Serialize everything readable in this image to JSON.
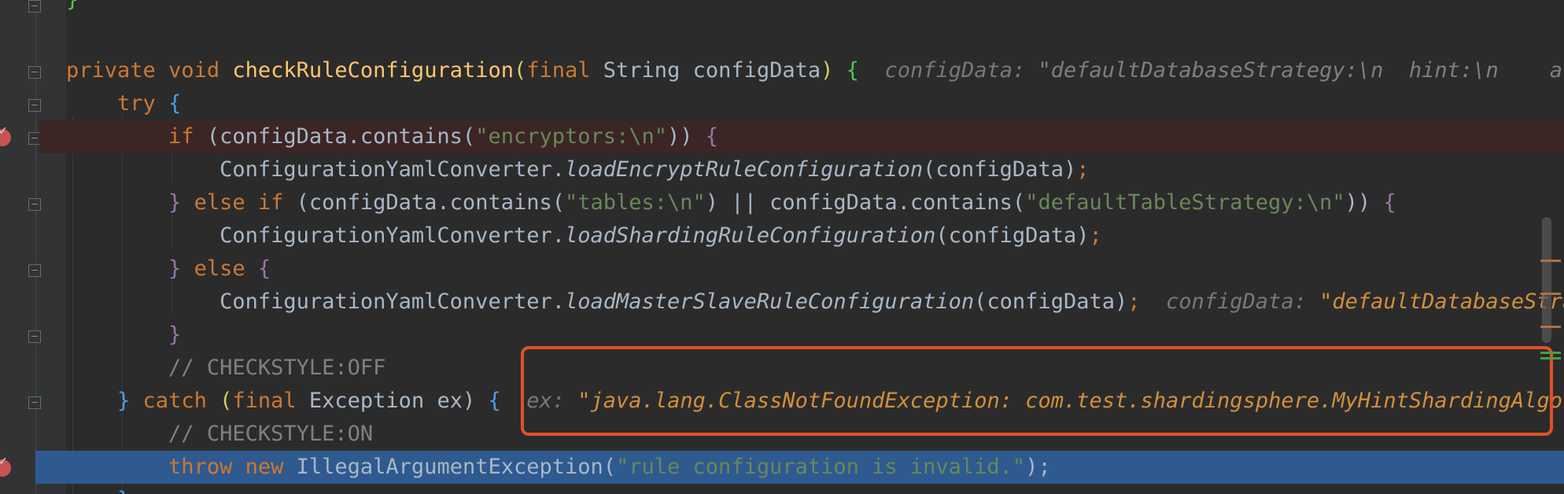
{
  "colors": {
    "background": "#2b2b2b",
    "keyword": "#cc7832",
    "method": "#ffc66d",
    "string": "#6a8759",
    "comment": "#808080",
    "execution_line": "#2f5a8f",
    "breakpoint_line": "#3b2525",
    "highlight_box": "#e0502a"
  },
  "lines": {
    "l0": {
      "brace": "}"
    },
    "l1": {
      "kw_private": "private",
      "kw_void": "void",
      "method": "checkRuleConfiguration",
      "open_paren": "(",
      "kw_final": "final",
      "params": " String configData",
      "close_paren": ")",
      "brace": " {",
      "inlay1_name": "configData:",
      "inlay1_value": " \"defaultDatabaseStrategy:\\n  hint:\\n    alg"
    },
    "l2": {
      "kw_try": "try",
      "brace": " {"
    },
    "l3": {
      "kw_if": "if",
      "pre": " (configData.contains(",
      "str": "\"encryptors:\\n\"",
      "post": "))",
      "brace": " {"
    },
    "l4": {
      "cls": "ConfigurationYamlConverter.",
      "method": "loadEncryptRuleConfiguration",
      "args": "(configData)",
      "semi": ";"
    },
    "l5": {
      "brace1": "}",
      "kw_else_if": " else if",
      "pre": " (configData.contains(",
      "str1": "\"tables:\\n\"",
      "mid": ") || configData.contains(",
      "str2": "\"defaultTableStrategy:\\n\"",
      "post": "))",
      "brace2": " {"
    },
    "l6": {
      "cls": "ConfigurationYamlConverter.",
      "method": "loadShardingRuleConfiguration",
      "args": "(configData)",
      "semi": ";"
    },
    "l7": {
      "brace1": "}",
      "kw_else": " else",
      "brace2": " {"
    },
    "l8": {
      "cls": "ConfigurationYamlConverter.",
      "method": "loadMasterSlaveRuleConfiguration",
      "args": "(configData)",
      "semi": ";",
      "inlay_name": "configData:",
      "inlay_value": " \"defaultDatabaseStrat"
    },
    "l9": {
      "brace": "}"
    },
    "l10": {
      "comment": "// CHECKSTYLE:OFF"
    },
    "l11": {
      "brace1": "}",
      "kw_catch": " catch",
      "open": " (",
      "kw_final": "final",
      "params": " Exception ex)",
      "brace2": " {",
      "inlay_name": "ex:",
      "inlay_value": " \"java.lang.ClassNotFoundException: com.test.shardingsphere.MyHintShardingAlgori"
    },
    "l12": {
      "comment": "// CHECKSTYLE:ON"
    },
    "l13": {
      "kw_throw": "throw",
      "kw_new": "new",
      "cls": " IllegalArgumentException(",
      "str": "\"rule configuration is invalid.\"",
      "post": ");"
    },
    "l14": {
      "brace": "}"
    }
  },
  "gutter_icons": [
    "fold-icon",
    "breakpoint-icon"
  ]
}
